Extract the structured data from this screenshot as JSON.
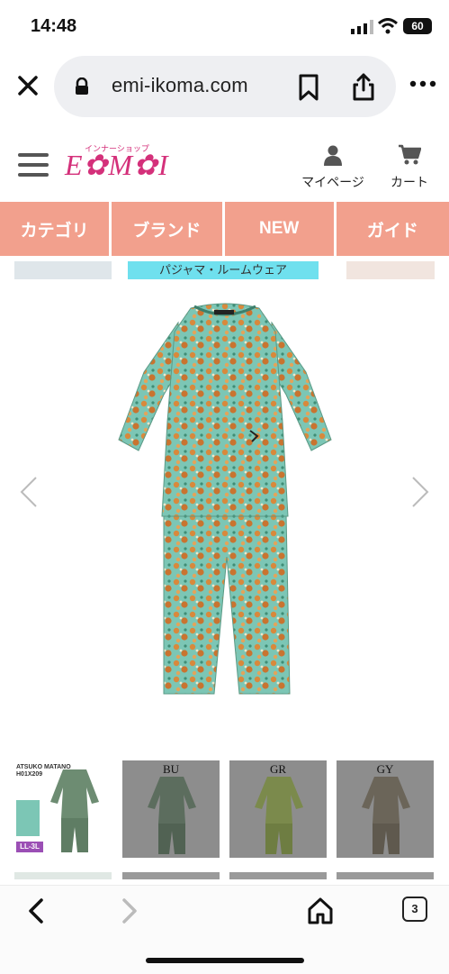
{
  "status_bar": {
    "time": "14:48",
    "battery": "60"
  },
  "browser": {
    "url": "emi-ikoma.com",
    "open_tabs": "3"
  },
  "site": {
    "logo_small": "インナーショップ",
    "logo_text": "E✿M✿I",
    "mypage_label": "マイページ",
    "cart_label": "カート"
  },
  "nav": {
    "items": [
      "カテゴリ",
      "ブランド",
      "NEW",
      "ガイド"
    ]
  },
  "carousel": {
    "category_label": "パジャマ・ルームウェア"
  },
  "thumbnails": [
    {
      "brand_text": "ATSUKO MATANO",
      "product_code": "H01X209",
      "size_badge": "LL-3L"
    },
    {
      "code": "BU"
    },
    {
      "code": "GR"
    },
    {
      "code": "GY"
    }
  ],
  "colors": {
    "nav_bg": "#f2a08d",
    "logo": "#d4307a",
    "category_tag": "#6fe0ee"
  }
}
